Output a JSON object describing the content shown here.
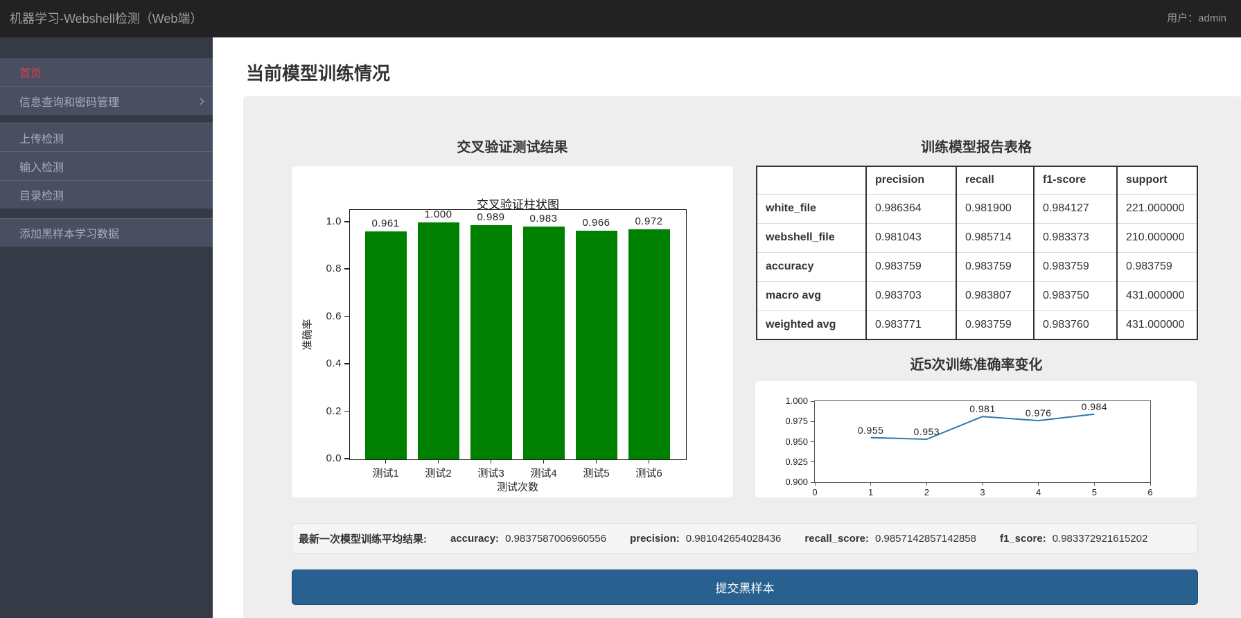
{
  "header": {
    "title": "机器学习-Webshell检测（Web端）",
    "user": "用户：admin"
  },
  "sidebar": {
    "items": [
      {
        "label": "首页",
        "active": true,
        "has_submenu": false
      },
      {
        "label": "信息查询和密码管理",
        "active": false,
        "has_submenu": true
      },
      {
        "label": "上传检测",
        "active": false,
        "has_submenu": false
      },
      {
        "label": "输入检测",
        "active": false,
        "has_submenu": false
      },
      {
        "label": "目录检测",
        "active": false,
        "has_submenu": false
      },
      {
        "label": "添加黑样本学习数据",
        "active": false,
        "has_submenu": false
      }
    ]
  },
  "page": {
    "title": "当前模型训练情况"
  },
  "sections": {
    "bar_chart_title": "交叉验证测试结果",
    "table_title": "训练模型报告表格",
    "line_chart_title": "近5次训练准确率变化"
  },
  "chart_data": [
    {
      "type": "bar",
      "title": "交叉验证柱状图",
      "categories": [
        "测试1",
        "测试2",
        "测试3",
        "测试4",
        "测试5",
        "测试6"
      ],
      "values": [
        0.961,
        1.0,
        0.989,
        0.983,
        0.966,
        0.972
      ],
      "value_labels": [
        "0.961",
        "1.000",
        "0.989",
        "0.983",
        "0.966",
        "0.972"
      ],
      "xlabel": "测试次数",
      "ylabel": "准确率",
      "ylim": [
        0,
        1.05
      ],
      "yticks": [
        0.0,
        0.2,
        0.4,
        0.6,
        0.8,
        1.0
      ],
      "bar_color": "#008001"
    },
    {
      "type": "line",
      "x": [
        1,
        2,
        3,
        4,
        5
      ],
      "values": [
        0.955,
        0.953,
        0.981,
        0.976,
        0.984
      ],
      "value_labels": [
        "0.955",
        "0.953",
        "0.981",
        "0.976",
        "0.984"
      ],
      "xlim": [
        0,
        6
      ],
      "ylim": [
        0.9,
        1.0
      ],
      "xticks": [
        0,
        1,
        2,
        3,
        4,
        5,
        6
      ],
      "yticks": [
        "1.000",
        "0.975",
        "0.950",
        "0.925",
        "0.900"
      ],
      "line_color": "#2e77ab"
    }
  ],
  "report_table": {
    "columns": [
      "",
      "precision",
      "recall",
      "f1-score",
      "support"
    ],
    "rows": [
      [
        "white_file",
        "0.986364",
        "0.981900",
        "0.984127",
        "221.000000"
      ],
      [
        "webshell_file",
        "0.981043",
        "0.985714",
        "0.983373",
        "210.000000"
      ],
      [
        "accuracy",
        "0.983759",
        "0.983759",
        "0.983759",
        "0.983759"
      ],
      [
        "macro avg",
        "0.983703",
        "0.983807",
        "0.983750",
        "431.000000"
      ],
      [
        "weighted avg",
        "0.983771",
        "0.983759",
        "0.983760",
        "431.000000"
      ]
    ]
  },
  "results_bar": {
    "prefix": "最新一次模型训练平均结果:",
    "metrics": [
      {
        "label": "accuracy:",
        "value": "0.9837587006960556"
      },
      {
        "label": "precision:",
        "value": "0.981042654028436"
      },
      {
        "label": "recall_score:",
        "value": "0.9857142857142858"
      },
      {
        "label": "f1_score:",
        "value": "0.983372921615202"
      }
    ]
  },
  "submit_button": {
    "label": "提交黑样本"
  },
  "colors": {
    "header_bg": "#222222",
    "sidebar_bg": "#363a47",
    "sidebar_item_bg": "#494f60",
    "active_item_red": "#db4055",
    "panel_bg": "#eeeeee",
    "bar_green": "#008001",
    "line_blue": "#2e77ab",
    "button_blue": "#286090"
  }
}
